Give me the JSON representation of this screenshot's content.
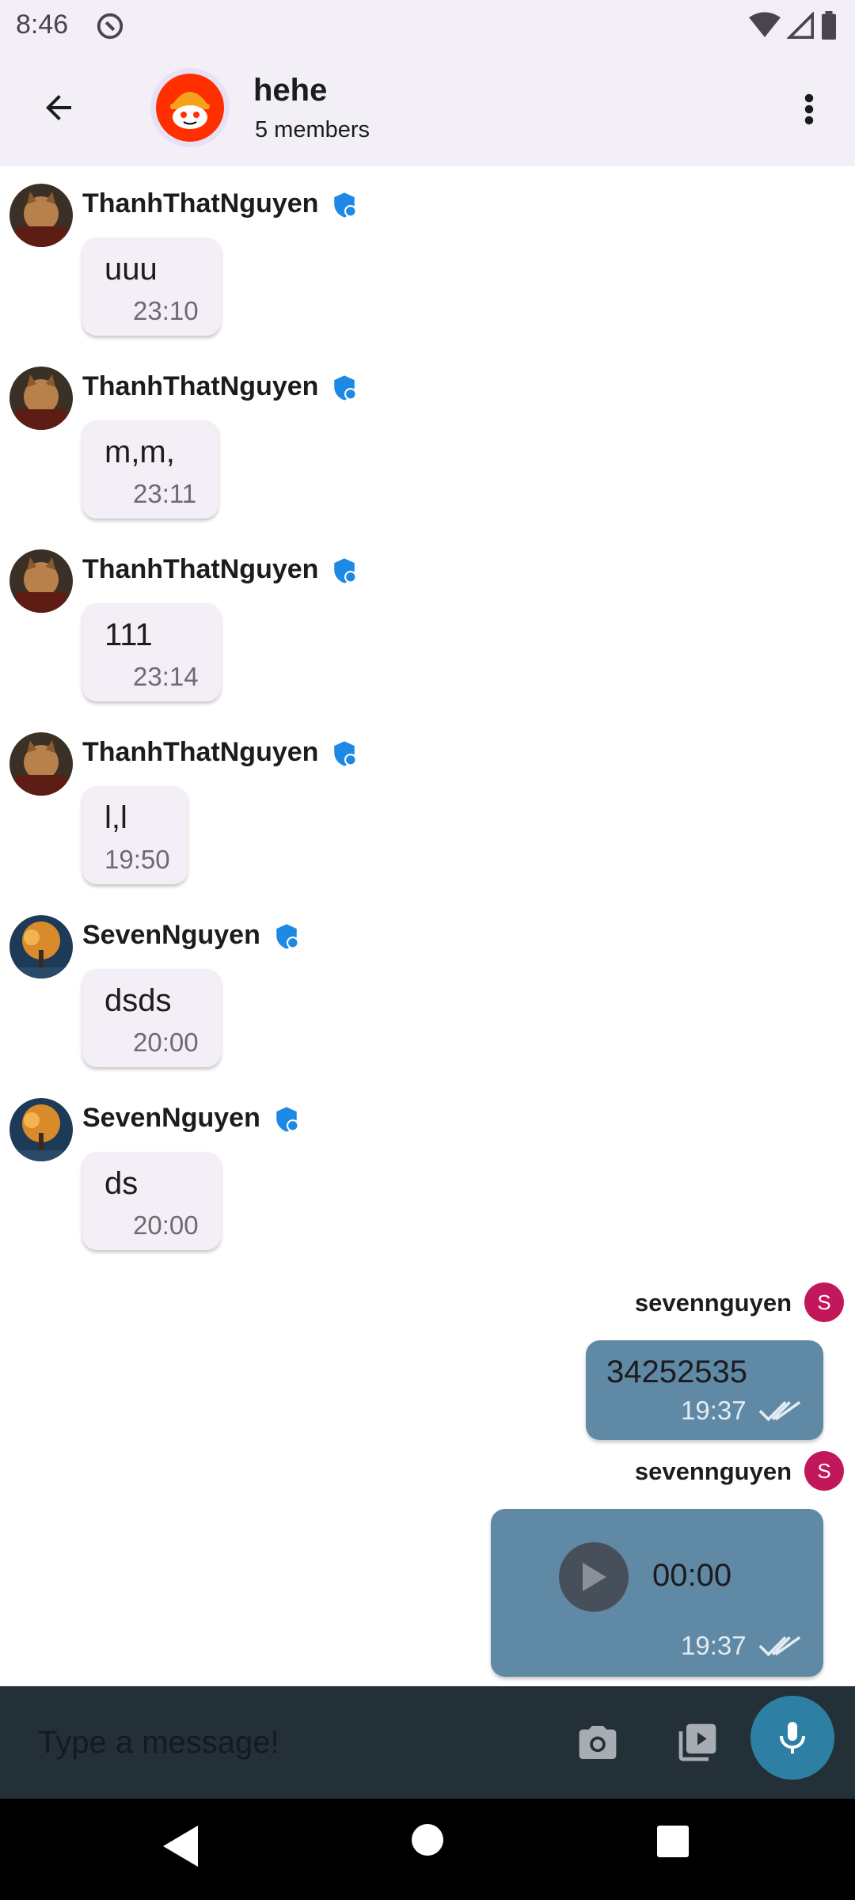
{
  "status_bar": {
    "time": "8:46",
    "icons": [
      "at-sign-icon",
      "wifi-icon",
      "signal-icon",
      "battery-icon"
    ]
  },
  "header": {
    "title": "hehe",
    "subtitle": "5 members",
    "back_icon": "arrow-back-icon",
    "menu_icon": "more-vert-icon"
  },
  "messages": [
    {
      "sender": "ThanhThatNguyen",
      "text": "uuu",
      "time": "23:10",
      "avatar": "dog-photo"
    },
    {
      "sender": "ThanhThatNguyen",
      "text": "m,m,",
      "time": "23:11",
      "avatar": "dog-photo"
    },
    {
      "sender": "ThanhThatNguyen",
      "text": "111",
      "time": "23:14",
      "avatar": "dog-photo"
    },
    {
      "sender": "ThanhThatNguyen",
      "text": "l,l",
      "time": "19:50",
      "avatar": "dog-photo"
    },
    {
      "sender": "SevenNguyen",
      "text": "dsds",
      "time": "20:00",
      "avatar": "tree-photo"
    },
    {
      "sender": "SevenNguyen",
      "text": "ds",
      "time": "20:00",
      "avatar": "tree-photo"
    }
  ],
  "own_messages": [
    {
      "sender": "sevennguyen",
      "avatar_initial": "S",
      "text": "34252535",
      "time": "19:37"
    },
    {
      "sender": "sevennguyen",
      "avatar_initial": "S",
      "voice_duration": "00:00",
      "time": "19:37"
    }
  ],
  "composer": {
    "placeholder": "Type a message!",
    "icons": [
      "camera-icon",
      "video-library-icon",
      "mic-icon"
    ]
  },
  "colors": {
    "app_bar": "#f3eff7",
    "incoming_bubble": "#f4eff6",
    "outgoing_bubble": "#5f89a4",
    "composer": "#243038",
    "mic_button": "#2e7fa4",
    "verified": "#1e88e5",
    "own_avatar": "#c2185b"
  }
}
